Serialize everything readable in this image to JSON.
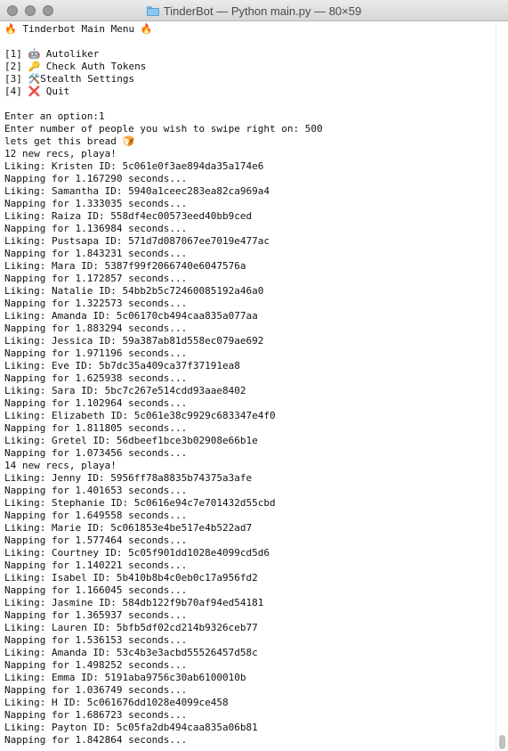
{
  "window": {
    "title": "TinderBot — Python main.py — 80×59",
    "scroll_fraction_visible": 0.02
  },
  "terminal": {
    "lines": [
      "🔥 Tinderbot Main Menu 🔥",
      "",
      "[1] 🤖 Autoliker",
      "[2] 🔑 Check Auth Tokens",
      "[3] 🛠️Stealth Settings",
      "[4] ❌ Quit",
      "",
      "Enter an option:1",
      "Enter number of people you wish to swipe right on: 500",
      "lets get this bread 🍞",
      "12 new recs, playa!",
      "Liking: Kristen ID: 5c061e0f3ae894da35a174e6",
      "Napping for 1.167290 seconds...",
      "Liking: Samantha ID: 5940a1ceec283ea82ca969a4",
      "Napping for 1.333035 seconds...",
      "Liking: Raiza ID: 558df4ec00573eed40bb9ced",
      "Napping for 1.136984 seconds...",
      "Liking: Pustsapa ID: 571d7d087067ee7019e477ac",
      "Napping for 1.843231 seconds...",
      "Liking: Mara ID: 5387f99f2066740e6047576a",
      "Napping for 1.172857 seconds...",
      "Liking: Natalie ID: 54bb2b5c72460085192a46a0",
      "Napping for 1.322573 seconds...",
      "Liking: Amanda ID: 5c06170cb494caa835a077aa",
      "Napping for 1.883294 seconds...",
      "Liking: Jessica ID: 59a387ab81d558ec079ae692",
      "Napping for 1.971196 seconds...",
      "Liking: Eve ID: 5b7dc35a409ca37f37191ea8",
      "Napping for 1.625938 seconds...",
      "Liking: Sara ID: 5bc7c267e514cdd93aae8402",
      "Napping for 1.102964 seconds...",
      "Liking: Elizabeth ID: 5c061e38c9929c683347e4f0",
      "Napping for 1.811805 seconds...",
      "Liking: Gretel ID: 56dbeef1bce3b02908e66b1e",
      "Napping for 1.073456 seconds...",
      "14 new recs, playa!",
      "Liking: Jenny ID: 5956ff78a8835b74375a3afe",
      "Napping for 1.401653 seconds...",
      "Liking: Stephanie ID: 5c0616e94c7e701432d55cbd",
      "Napping for 1.649558 seconds...",
      "Liking: Marie ID: 5c061853e4be517e4b522ad7",
      "Napping for 1.577464 seconds...",
      "Liking: Courtney ID: 5c05f901dd1028e4099cd5d6",
      "Napping for 1.140221 seconds...",
      "Liking: Isabel ID: 5b410b8b4c0eb0c17a956fd2",
      "Napping for 1.166045 seconds...",
      "Liking: Jasmine ID: 584db122f9b70af94ed54181",
      "Napping for 1.365937 seconds...",
      "Liking: Lauren ID: 5bfb5df02cd214b9326ceb77",
      "Napping for 1.536153 seconds...",
      "Liking: Amanda ID: 53c4b3e3acbd55526457d58c",
      "Napping for 1.498252 seconds...",
      "Liking: Emma ID: 5191aba9756c30ab6100010b",
      "Napping for 1.036749 seconds...",
      "Liking: H ID: 5c061676dd1028e4099ce458",
      "Napping for 1.686723 seconds...",
      "Liking: Payton ID: 5c05fa2db494caa835a06b81",
      "Napping for 1.842864 seconds..."
    ]
  }
}
